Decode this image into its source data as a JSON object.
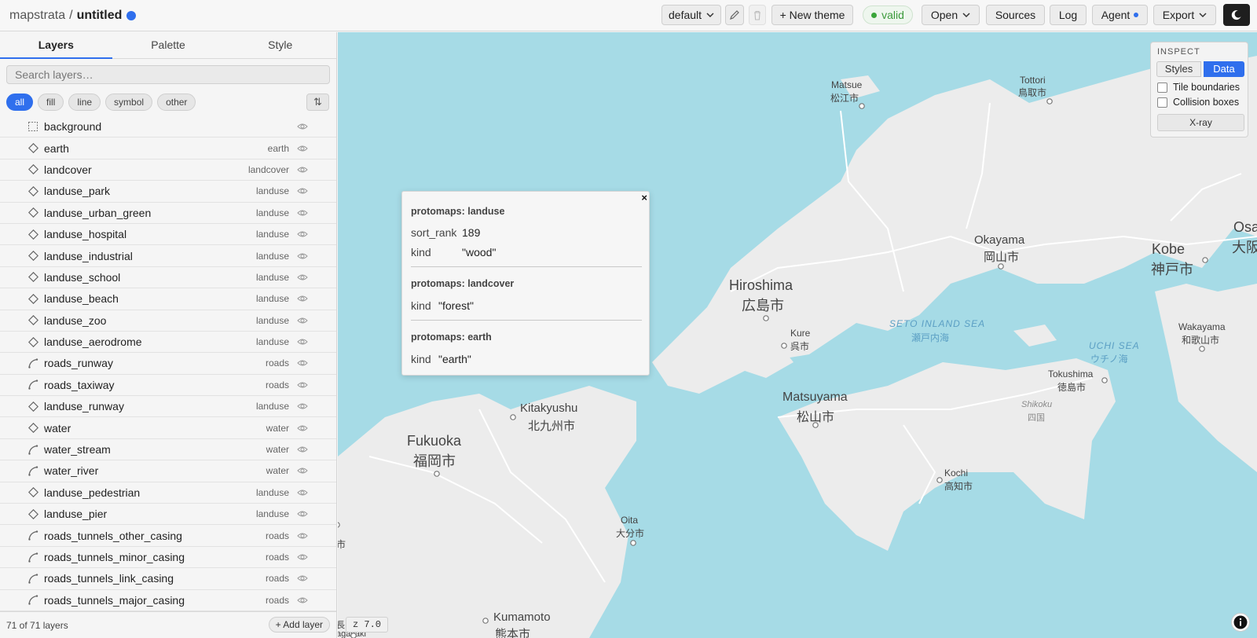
{
  "app": {
    "name": "mapstrata",
    "separator": "/",
    "document": "untitled"
  },
  "toolbar": {
    "theme_select": "default",
    "new_theme": "+ New theme",
    "status": "valid",
    "open": "Open",
    "sources": "Sources",
    "log": "Log",
    "agent": "Agent",
    "export": "Export"
  },
  "sidebar": {
    "tabs": [
      "Layers",
      "Palette",
      "Style"
    ],
    "active_tab": "Layers",
    "search_placeholder": "Search layers…",
    "filters": [
      "all",
      "fill",
      "line",
      "symbol",
      "other"
    ],
    "active_filter": "all",
    "layers": [
      {
        "name": "background",
        "source": "",
        "type": "background"
      },
      {
        "name": "earth",
        "source": "earth",
        "type": "fill"
      },
      {
        "name": "landcover",
        "source": "landcover",
        "type": "fill"
      },
      {
        "name": "landuse_park",
        "source": "landuse",
        "type": "fill"
      },
      {
        "name": "landuse_urban_green",
        "source": "landuse",
        "type": "fill"
      },
      {
        "name": "landuse_hospital",
        "source": "landuse",
        "type": "fill"
      },
      {
        "name": "landuse_industrial",
        "source": "landuse",
        "type": "fill"
      },
      {
        "name": "landuse_school",
        "source": "landuse",
        "type": "fill"
      },
      {
        "name": "landuse_beach",
        "source": "landuse",
        "type": "fill"
      },
      {
        "name": "landuse_zoo",
        "source": "landuse",
        "type": "fill"
      },
      {
        "name": "landuse_aerodrome",
        "source": "landuse",
        "type": "fill"
      },
      {
        "name": "roads_runway",
        "source": "roads",
        "type": "line"
      },
      {
        "name": "roads_taxiway",
        "source": "roads",
        "type": "line"
      },
      {
        "name": "landuse_runway",
        "source": "landuse",
        "type": "fill"
      },
      {
        "name": "water",
        "source": "water",
        "type": "fill"
      },
      {
        "name": "water_stream",
        "source": "water",
        "type": "line"
      },
      {
        "name": "water_river",
        "source": "water",
        "type": "line"
      },
      {
        "name": "landuse_pedestrian",
        "source": "landuse",
        "type": "fill"
      },
      {
        "name": "landuse_pier",
        "source": "landuse",
        "type": "fill"
      },
      {
        "name": "roads_tunnels_other_casing",
        "source": "roads",
        "type": "line"
      },
      {
        "name": "roads_tunnels_minor_casing",
        "source": "roads",
        "type": "line"
      },
      {
        "name": "roads_tunnels_link_casing",
        "source": "roads",
        "type": "line"
      },
      {
        "name": "roads_tunnels_major_casing",
        "source": "roads",
        "type": "line"
      }
    ],
    "layer_count": "71 of 71 layers",
    "add_layer": "+ Add layer"
  },
  "popup": {
    "close": "×",
    "sections": [
      {
        "header": "protomaps: landuse",
        "rows": [
          {
            "key": "sort_rank",
            "value": "189"
          },
          {
            "key": "kind",
            "value": "\"wood\""
          }
        ]
      },
      {
        "header": "protomaps: landcover",
        "rows": [
          {
            "key": "kind",
            "value": "\"forest\""
          }
        ]
      },
      {
        "header": "protomaps: earth",
        "rows": [
          {
            "key": "kind",
            "value": "\"earth\""
          }
        ]
      }
    ]
  },
  "inspect": {
    "title": "INSPECT",
    "styles": "Styles",
    "data": "Data",
    "active": "Data",
    "tile_boundaries": "Tile boundaries",
    "tile_boundaries_checked": false,
    "collision_boxes": "Collision boxes",
    "collision_boxes_checked": false,
    "xray": "X-ray"
  },
  "map": {
    "zoom_label": "z 7.0",
    "labels": {
      "matsue_en": "Matsue",
      "matsue_jp": "松江市",
      "tottori_en": "Tottori",
      "tottori_jp": "鳥取市",
      "okayama_en": "Okayama",
      "okayama_jp": "岡山市",
      "kobe_en": "Kobe",
      "kobe_jp": "神戸市",
      "osaka_en": "Osa",
      "osaka_jp": "大阪",
      "hiroshima_en": "Hiroshima",
      "hiroshima_jp": "広島市",
      "kure_en": "Kure",
      "kure_jp": "呉市",
      "seto_en": "SETO INLAND SEA",
      "seto_jp": "瀬戸内海",
      "uchi_en": "UCHI SEA",
      "uchi_jp": "ウチノ海",
      "wakayama_en": "Wakayama",
      "wakayama_jp": "和歌山市",
      "tokushima_en": "Tokushima",
      "tokushima_jp": "徳島市",
      "shikoku_en": "Shikoku",
      "shikoku_jp": "四国",
      "matsuyama_en": "Matsuyama",
      "matsuyama_jp": "松山市",
      "kitakyushu_en": "Kitakyushu",
      "kitakyushu_jp": "北九州市",
      "fukuoka_en": "Fukuoka",
      "fukuoka_jp": "福岡市",
      "kochi_en": "Kochi",
      "kochi_jp": "高知市",
      "oita_en": "Oita",
      "oita_jp": "大分市",
      "kumamoto_en": "Kumamoto",
      "kumamoto_jp": "熊本市",
      "edge_left_jp": "市",
      "nagasaki_partial": "agasaki",
      "nagasaki_jp_partial": "長"
    }
  },
  "colors": {
    "accent": "#2f6fed",
    "water": "#a6dbe6",
    "land": "#ececec",
    "valid": "#3aa53a"
  }
}
